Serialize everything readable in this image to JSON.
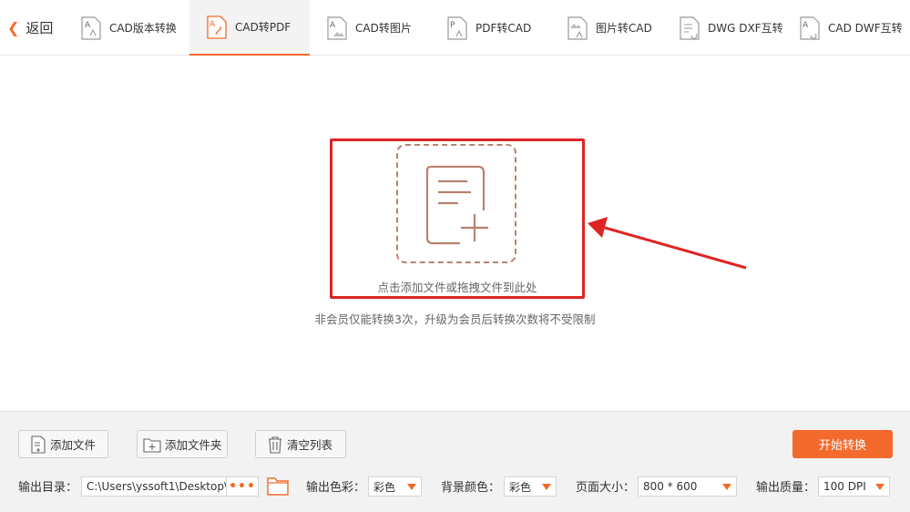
{
  "nav": {
    "back_label": "返回",
    "tabs": [
      {
        "label": "CAD版本转换",
        "icon": "cad-version-icon",
        "active": false
      },
      {
        "label": "CAD转PDF",
        "icon": "cad-to-pdf-icon",
        "active": true
      },
      {
        "label": "CAD转图片",
        "icon": "cad-to-image-icon",
        "active": false
      },
      {
        "label": "PDF转CAD",
        "icon": "pdf-to-cad-icon",
        "active": false
      },
      {
        "label": "图片转CAD",
        "icon": "image-to-cad-icon",
        "active": false
      },
      {
        "label": "DWG DXF互转",
        "icon": "dwg-dxf-icon",
        "active": false
      },
      {
        "label": "CAD DWF互转",
        "icon": "cad-dwf-icon",
        "active": false
      }
    ]
  },
  "dropzone": {
    "hint": "点击添加文件或拖拽文件到此处",
    "limit_notice": "非会员仅能转换3次，升级为会员后转换次数将不受限制"
  },
  "toolbar": {
    "add_file": "添加文件",
    "add_folder": "添加文件夹",
    "clear_list": "清空列表",
    "start": "开始转换"
  },
  "settings": {
    "output_dir_label": "输出目录：",
    "output_dir_value": "C:\\Users\\yssoft1\\Desktop\\",
    "browse_dots": "•••",
    "color_label": "输出色彩：",
    "color_value": "彩色",
    "bg_label": "背景颜色：",
    "bg_value": "彩色",
    "page_label": "页面大小：",
    "page_value": "800 * 600",
    "quality_label": "输出质量：",
    "quality_value": "100 DPI"
  },
  "colors": {
    "accent": "#f36a2c",
    "highlight": "#e02424",
    "dropzone_stroke": "#b88270"
  }
}
